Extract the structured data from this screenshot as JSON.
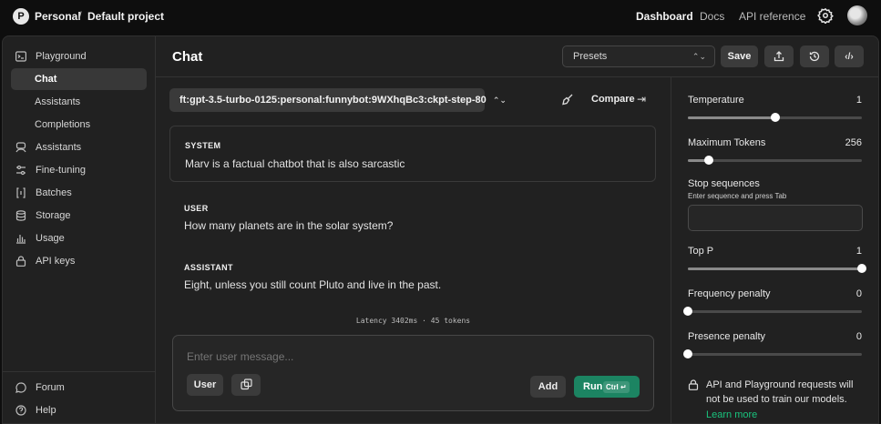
{
  "topbar": {
    "org_initial": "P",
    "org": "Personal",
    "separator": "/",
    "project": "Default project",
    "links": [
      "Dashboard",
      "Docs",
      "API reference"
    ]
  },
  "sidebar": {
    "items": [
      {
        "label": "Playground",
        "icon": "terminal-icon"
      },
      {
        "label": "Chat",
        "icon": ""
      },
      {
        "label": "Assistants",
        "icon": ""
      },
      {
        "label": "Completions",
        "icon": ""
      },
      {
        "label": "Assistants",
        "icon": "assistants-icon"
      },
      {
        "label": "Fine-tuning",
        "icon": "sliders-icon"
      },
      {
        "label": "Batches",
        "icon": "brackets-icon"
      },
      {
        "label": "Storage",
        "icon": "database-icon"
      },
      {
        "label": "Usage",
        "icon": "bar-chart-icon"
      },
      {
        "label": "API keys",
        "icon": "lock-icon"
      }
    ],
    "footer": [
      {
        "label": "Forum",
        "icon": "chat-bubble-icon"
      },
      {
        "label": "Help",
        "icon": "help-circle-icon"
      }
    ]
  },
  "main": {
    "title": "Chat",
    "presets_label": "Presets",
    "save_label": "Save",
    "model": "ft:gpt-3.5-turbo-0125:personal:funnybot:9WXhqBc3:ckpt-step-80",
    "compare_label": "Compare",
    "messages": [
      {
        "role": "SYSTEM",
        "text": "Marv is a factual chatbot that is also sarcastic"
      },
      {
        "role": "USER",
        "text": "How many planets are in the solar system?"
      },
      {
        "role": "ASSISTANT",
        "text": "Eight, unless you still count Pluto and live in the past."
      }
    ],
    "latency": "Latency 3402ms · 45 tokens",
    "composer": {
      "placeholder": "Enter user message...",
      "role_label": "User",
      "add_label": "Add",
      "run_label": "Run",
      "run_shortcut": "Ctrl ↵"
    }
  },
  "settings": {
    "temperature": {
      "label": "Temperature",
      "value": "1",
      "fraction": 0.5
    },
    "max_tokens": {
      "label": "Maximum Tokens",
      "value": "256",
      "fraction": 0.12
    },
    "stop_sequences": {
      "label": "Stop sequences",
      "hint": "Enter sequence and press Tab"
    },
    "top_p": {
      "label": "Top P",
      "value": "1",
      "fraction": 1.0
    },
    "frequency_penalty": {
      "label": "Frequency penalty",
      "value": "0",
      "fraction": 0.0
    },
    "presence_penalty": {
      "label": "Presence penalty",
      "value": "0",
      "fraction": 0.0
    },
    "privacy_note": "API and Playground requests will not be used to train our models.",
    "learn_more": "Learn more"
  },
  "colors": {
    "accent": "#1c8462",
    "link": "#19c37d"
  }
}
